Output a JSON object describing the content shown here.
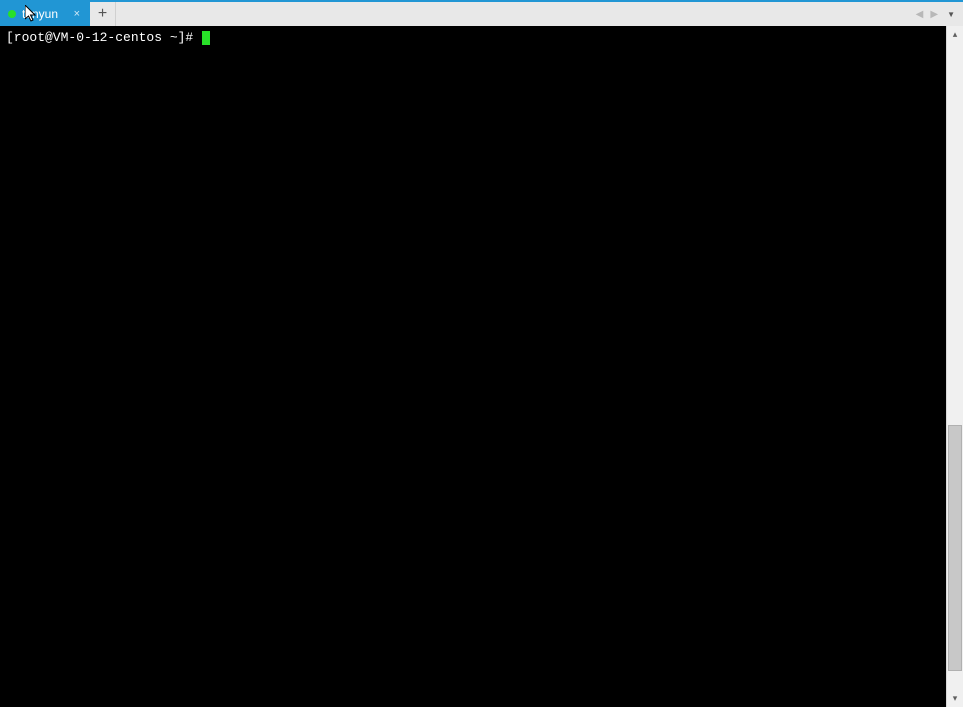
{
  "tabs": [
    {
      "label": "tenyun",
      "status": "connected"
    }
  ],
  "terminal": {
    "prompt": "[root@VM-0-12-centos ~]# "
  },
  "colors": {
    "tab_active": "#2196d4",
    "status_connected": "#28e028",
    "cursor": "#28e028",
    "terminal_bg": "#000000",
    "terminal_fg": "#ffffff"
  },
  "scrollbar": {
    "thumb_top_pct": 59,
    "thumb_height_pct": 38
  }
}
